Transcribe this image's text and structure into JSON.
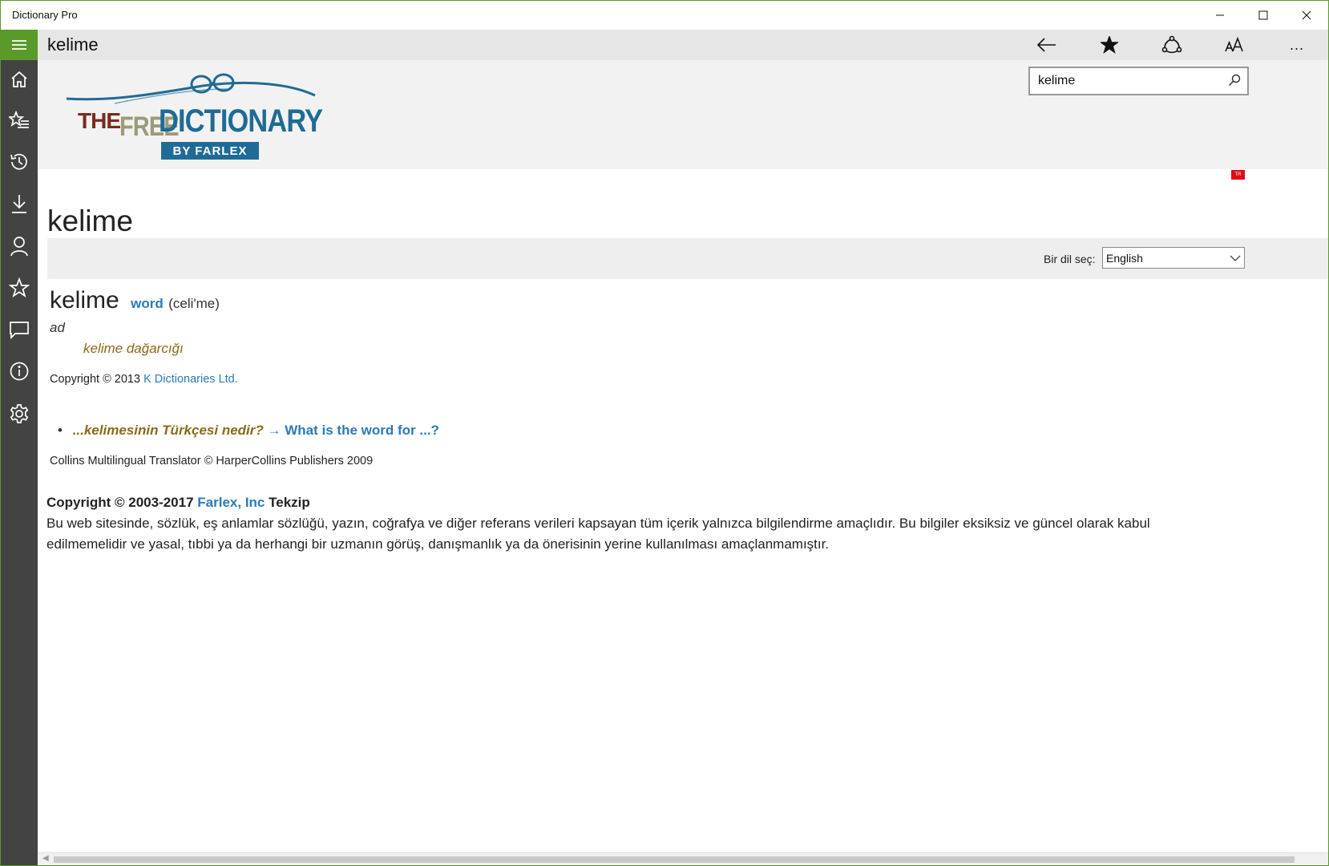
{
  "window": {
    "title": "Dictionary Pro",
    "controls": {
      "minimize": "─",
      "maximize": "☐",
      "close": "✕"
    }
  },
  "nav": {
    "items": [
      {
        "icon": "home-icon"
      },
      {
        "icon": "favorites-list-icon"
      },
      {
        "icon": "history-icon"
      },
      {
        "icon": "download-icon"
      },
      {
        "icon": "profile-icon"
      },
      {
        "icon": "star-icon"
      },
      {
        "icon": "feedback-icon"
      },
      {
        "icon": "info-icon"
      },
      {
        "icon": "settings-icon"
      }
    ]
  },
  "appbar": {
    "heading": "kelime",
    "more_label": "..."
  },
  "banner": {
    "logo": {
      "the": "THE",
      "free": "FREE",
      "dictionary": "DICTIONARY",
      "by": "BY FARLEX"
    },
    "search_value": "kelime"
  },
  "content": {
    "flag_label": "TR",
    "word_title": "kelime",
    "language_label": "Bir dil seç:",
    "language_selected": "English",
    "entry": {
      "headword": "kelime",
      "translation": "word",
      "pronunciation": "(celi'me)",
      "part_of_speech": "ad",
      "example": "kelime dağarcığı",
      "copyright_prefix": "Copyright © 2013",
      "copyright_link": "K Dictionaries Ltd."
    },
    "bullet": {
      "dot": "•",
      "question": "...kelimesinin Türkçesi nedir?",
      "answer": "→ What is the word for ...?"
    },
    "collins": "Collins Multilingual Translator © HarperCollins Publishers 2009",
    "footer": {
      "copyright": "Copyright © 2003-2017",
      "farlex": "Farlex, Inc",
      "tekzip": "Tekzip",
      "disclaimer": "Bu web sitesinde, sözlük, eş anlamlar sözlüğü, yazın, coğrafya ve diğer referans verileri kapsayan tüm içerik yalnızca bilgilendirme amaçlıdır. Bu bilgiler eksiksiz ve güncel olarak kabul edilmemelidir ve yasal, tıbbi ya da herhangi bir uzmanın görüş, danışmanlık ya da önerisinin yerine kullanılması amaçlanmamıştır."
    }
  },
  "colors": {
    "accent": "#5a9a2a",
    "nav_bg": "#434343",
    "link": "#2a7ab8",
    "example": "#8a6a1a",
    "logo_blue": "#1f6b96"
  }
}
